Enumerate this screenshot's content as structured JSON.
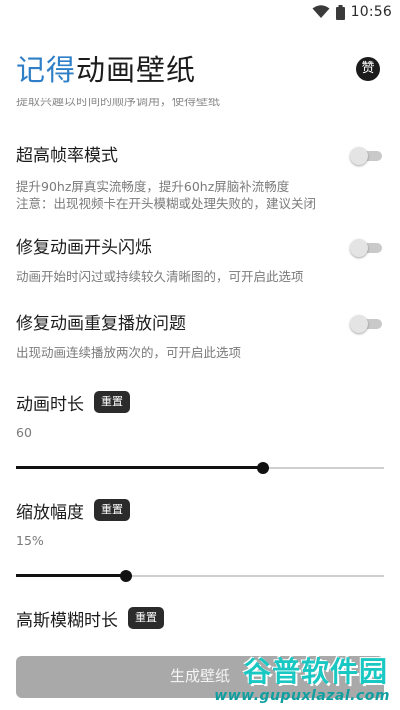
{
  "status_bar": {
    "time": "10:56"
  },
  "header": {
    "title_accent": "记得",
    "title_rest": "动画壁纸",
    "like_label": "赞"
  },
  "clipped_top_text": "提取兴趣以时间的顺序调用，使得壁纸",
  "settings": [
    {
      "title": "超高帧率模式",
      "desc_lines": [
        "提升90hz屏真实流畅度，提升60hz屏脑补流畅度",
        "注意：出现视频卡在开头模糊或处理失败的，建议关闭"
      ],
      "enabled": false
    },
    {
      "title": "修复动画开头闪烁",
      "desc_lines": [
        "动画开始时闪过或持续较久清晰图的，可开启此选项"
      ],
      "enabled": false
    },
    {
      "title": "修复动画重复播放问题",
      "desc_lines": [
        "出现动画连续播放两次的，可开启此选项"
      ],
      "enabled": false
    }
  ],
  "sliders": [
    {
      "title": "动画时长",
      "reset_label": "重置",
      "value_text": "60",
      "fraction": 0.67
    },
    {
      "title": "缩放幅度",
      "reset_label": "重置",
      "value_text": "15%",
      "fraction": 0.3
    },
    {
      "title": "高斯模糊时长",
      "reset_label": "重置"
    }
  ],
  "generate_button": {
    "label": "生成壁纸"
  },
  "watermark": {
    "name": "谷普软件园",
    "url": "www.gupuxlazal.com"
  },
  "colors": {
    "accent": "#2e7fc7",
    "button_disabled": "#a9a9a9",
    "watermark": "#19c8c2"
  },
  "icons": {
    "wifi": "wifi-icon",
    "battery": "battery-icon"
  }
}
